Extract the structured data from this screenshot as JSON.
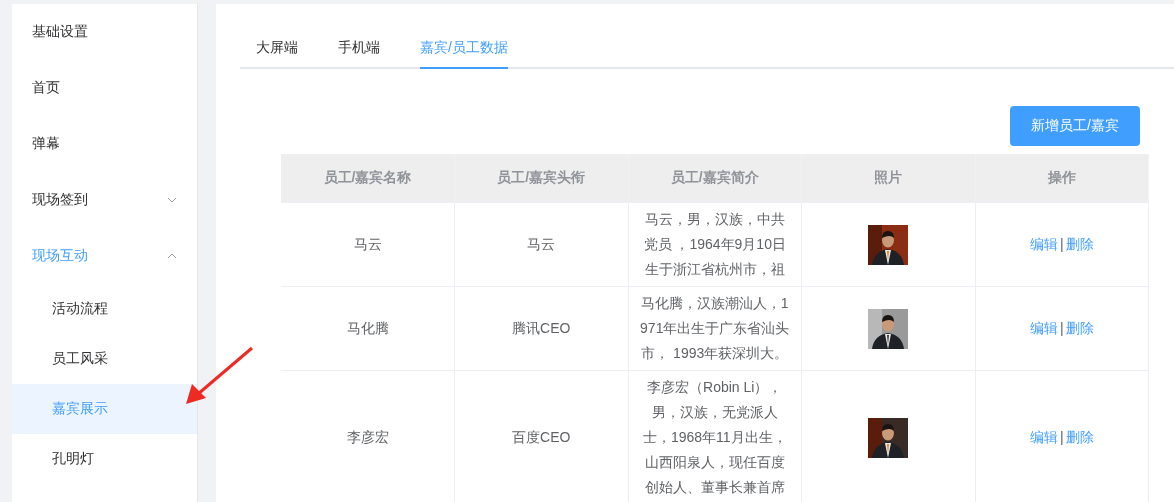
{
  "sidebar": {
    "items": [
      {
        "label": "基础设置",
        "kind": "item",
        "selected": false
      },
      {
        "label": "首页",
        "kind": "item",
        "selected": false
      },
      {
        "label": "弹幕",
        "kind": "item",
        "selected": false
      },
      {
        "label": "现场签到",
        "kind": "submenu",
        "expanded": false,
        "selected": false
      },
      {
        "label": "现场互动",
        "kind": "submenu",
        "expanded": true,
        "selected": true,
        "children": [
          {
            "label": "活动流程",
            "selected": false
          },
          {
            "label": "员工风采",
            "selected": false
          },
          {
            "label": "嘉宾展示",
            "selected": true
          },
          {
            "label": "孔明灯",
            "selected": false
          }
        ]
      }
    ]
  },
  "tabs": [
    {
      "label": "大屏端",
      "selected": false
    },
    {
      "label": "手机端",
      "selected": false
    },
    {
      "label": "嘉宾/员工数据",
      "selected": true
    }
  ],
  "add_button": "新增员工/嘉宾",
  "table": {
    "columns": [
      "员工/嘉宾名称",
      "员工/嘉宾头衔",
      "员工/嘉宾简介",
      "照片",
      "操作"
    ],
    "rows": [
      {
        "name": "马云",
        "title": "马云",
        "intro": "马云，男，汉族，中共党员 ，1964年9月10日生于浙江省杭州市，祖",
        "actions": {
          "edit": "编辑",
          "separator": "|",
          "delete": "删除"
        }
      },
      {
        "name": "马化腾",
        "title": "腾讯CEO",
        "intro": "马化腾，汉族潮汕人，1971年出生于广东省汕头市， 1993年获深圳大。",
        "actions": {
          "edit": "编辑",
          "separator": "|",
          "delete": "删除"
        }
      },
      {
        "name": "李彦宏",
        "title": "百度CEO",
        "intro": "李彦宏（Robin Li），男，汉族，无党派人士，1968年11月出生，山西阳泉人，现任百度创始人、董事长兼首席",
        "actions": {
          "edit": "编辑",
          "separator": "|",
          "delete": "删除"
        }
      }
    ]
  }
}
